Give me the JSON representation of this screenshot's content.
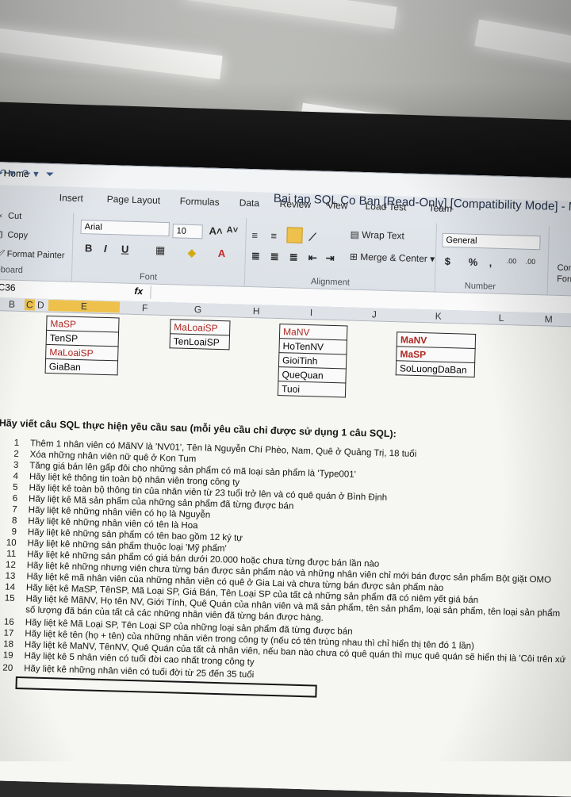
{
  "window": {
    "title": "Bai tap SQL Co Ban  [Read-Only]  [Compatibility Mode]  -  M"
  },
  "ribbon": {
    "tabs": [
      "Home",
      "Insert",
      "Page Layout",
      "Formulas",
      "Data",
      "Review",
      "View",
      "Load Test",
      "Team"
    ],
    "clipboard": {
      "cut": "Cut",
      "copy": "Copy",
      "format_painter": "Format Painter",
      "label": "ipboard"
    },
    "font": {
      "name": "Arial",
      "size": "10",
      "label": "Font"
    },
    "alignment": {
      "wrap": "Wrap Text",
      "merge": "Merge & Center",
      "label": "Alignment"
    },
    "number": {
      "format": "General",
      "label": "Number",
      "cond1": "Cond",
      "cond2": "Forma"
    }
  },
  "formula_bar": {
    "cell_ref": "C36",
    "fx": "fx"
  },
  "columns": [
    "B",
    "C",
    "D",
    "E",
    "F",
    "G",
    "H",
    "I",
    "J",
    "K",
    "L",
    "M"
  ],
  "tables": {
    "sanpham": [
      "MaSP",
      "TenSP",
      "MaLoaiSP",
      "GiaBan"
    ],
    "loaisp": [
      "MaLoaiSP",
      "TenLoaiSP"
    ],
    "nhanvien": [
      "MaNV",
      "HoTenNV",
      "GioiTinh",
      "QueQuan",
      "Tuoi"
    ],
    "banhang": [
      "MaNV",
      "MaSP",
      "SoLuongDaBan"
    ]
  },
  "heading": "Hãy viết câu SQL thực hiện yêu cầu sau (mỗi yêu cầu chỉ được sử dụng 1 câu SQL):",
  "questions": [
    {
      "n": "1",
      "text": "Thêm 1 nhân viên có MãNV là 'NV01', Tên là Nguyễn Chí Phèo, Nam, Quê ở Quảng Trị, 18 tuổi"
    },
    {
      "n": "2",
      "text": "Xóa những nhân viên nữ quê ở Kon Tum"
    },
    {
      "n": "3",
      "text": "Tăng giá bán lên gấp đôi cho những sản phẩm có mã loại sản phẩm là 'Type001'"
    },
    {
      "n": "4",
      "text": "Hãy liệt kê thông tin toàn bộ nhân viên trong công ty"
    },
    {
      "n": "5",
      "text": "Hãy liệt kê toàn bộ thông tin của nhân viên từ 23 tuổi trở lên và có quê quán ở Bình Định"
    },
    {
      "n": "6",
      "text": "Hãy liệt kê Mã sản phẩm của những sản phẩm đã từng được bán"
    },
    {
      "n": "7",
      "text": "Hãy liệt kê những nhân viên có họ là Nguyễn"
    },
    {
      "n": "8",
      "text": "Hãy liệt kê những nhân viên có tên là Hoa"
    },
    {
      "n": "9",
      "text": "Hãy liệt kê những sản phẩm có tên bao gồm 12 ký tự"
    },
    {
      "n": "10",
      "text": "Hãy liệt kê những sản phẩm thuộc loại 'Mỹ phẩm'"
    },
    {
      "n": "11",
      "text": "Hãy liệt kê những sản phẩm có giá bán dưới 20.000 hoặc chưa từng được bán lần nào"
    },
    {
      "n": "12",
      "text": "Hãy liệt kê những nhưng viên chưa từng bán được sản phẩm nào và những nhân viên chỉ mới bán được sản phẩm Bột giặt OMO"
    },
    {
      "n": "13",
      "text": "Hãy liệt kê mã nhân viên của những nhân viên có quê ở Gia Lai và chưa từng bán được sản phẩm nào"
    },
    {
      "n": "14",
      "text": "Hãy liệt kê MaSP, TênSP, Mã Loại SP, Giá Bán, Tên Loại SP của tất cả những sản phẩm đã có niêm yết giá bán"
    },
    {
      "n": "15",
      "text": "Hãy liệt kê MãNV, Họ tên NV, Giới Tính, Quê Quán của nhân viên và mã sản phẩm, tên sản phẩm, loại sản phẩm, tên loại sản phẩm"
    },
    {
      "n": "",
      "text": "số lượng đã bán của tất cả các những nhân viên đã từng bán được hàng."
    },
    {
      "n": "16",
      "text": "Hãy liệt kê Mã Loại SP, Tên Loại SP của những loại sản phẩm đã từng được bán"
    },
    {
      "n": "17",
      "text": "Hãy liệt kê tên (họ + tên) của những nhân viên trong công ty (nếu có tên trùng nhau thì chỉ hiển thị tên đó 1 lần)"
    },
    {
      "n": "18",
      "text": "Hãy liệt kê MaNV, TênNV, Quê Quán của tất cả nhân viên, nếu ban nào chưa có quê quán thì mục quê quán sẽ hiển thị là 'Côi trên xứ"
    },
    {
      "n": "19",
      "text": "Hãy liệt kê 5 nhân viên có tuổi đời cao nhất trong công ty"
    },
    {
      "n": "20",
      "text": "Hãy liệt kê những nhân viên có tuổi đời từ 25 đến 35 tuổi"
    }
  ]
}
